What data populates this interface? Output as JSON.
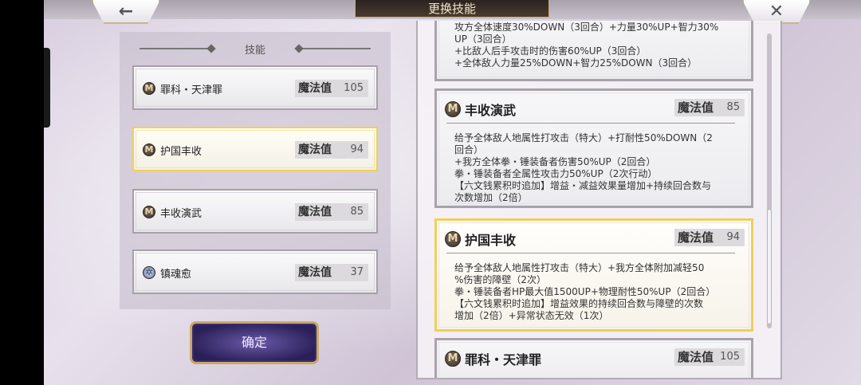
{
  "header": {
    "title": "更换技能",
    "back_glyph": "←",
    "close_glyph": "✕"
  },
  "left_panel": {
    "title": "技能",
    "skills": [
      {
        "name": "罪科・天津罪",
        "mp_label": "魔法值",
        "mp": "105",
        "icon": "skill-emblem-icon"
      },
      {
        "name": "护国丰收",
        "mp_label": "魔法值",
        "mp": "94",
        "icon": "skill-emblem-icon",
        "selected": true
      },
      {
        "name": "丰收演武",
        "mp_label": "魔法值",
        "mp": "85",
        "icon": "skill-emblem-icon"
      },
      {
        "name": "镇魂愈",
        "mp_label": "魔法值",
        "mp": "37",
        "icon": "snowflake-icon"
      }
    ],
    "confirm_label": "确定"
  },
  "right_panel": {
    "top_card_desc": [
      "攻方全体速度30%DOWN（3回合）+力量30%UP+智力30%",
      "UP（3回合）",
      "+比敌人后手攻击时的伤害60%UP（3回合）",
      "+全体敌人力量25%DOWN+智力25%DOWN（3回合）"
    ],
    "cards": [
      {
        "name": "丰收演武",
        "mp_label": "魔法值",
        "mp": "85",
        "desc": [
          "给予全体敌人地属性打攻击（特大）+打耐性50%DOWN（2",
          "回合）",
          "+我方全体拳・锤装备者伤害50%UP（2回合）",
          "拳・锤装备者全属性攻击力50%UP（2次行动）",
          "【六文钱累积时追加】增益・减益效果量增加+持续回合数与",
          "次数增加（2倍）"
        ]
      },
      {
        "name": "护国丰收",
        "mp_label": "魔法值",
        "mp": "94",
        "desc": [
          "给予全体敌人地属性打攻击（特大）+我方全体附加减轻50",
          "%伤害的障壁（2次）",
          "拳・锤装备者HP最大值1500UP+物理耐性50%UP（2回合）",
          "【六文钱累积时追加】增益效果的持续回合数与障壁的次数",
          "增加（2倍）+异常状态无效（1次）"
        ]
      },
      {
        "name": "罪科・天津罪",
        "mp_label": "魔法值",
        "mp": "105",
        "desc": []
      }
    ]
  }
}
